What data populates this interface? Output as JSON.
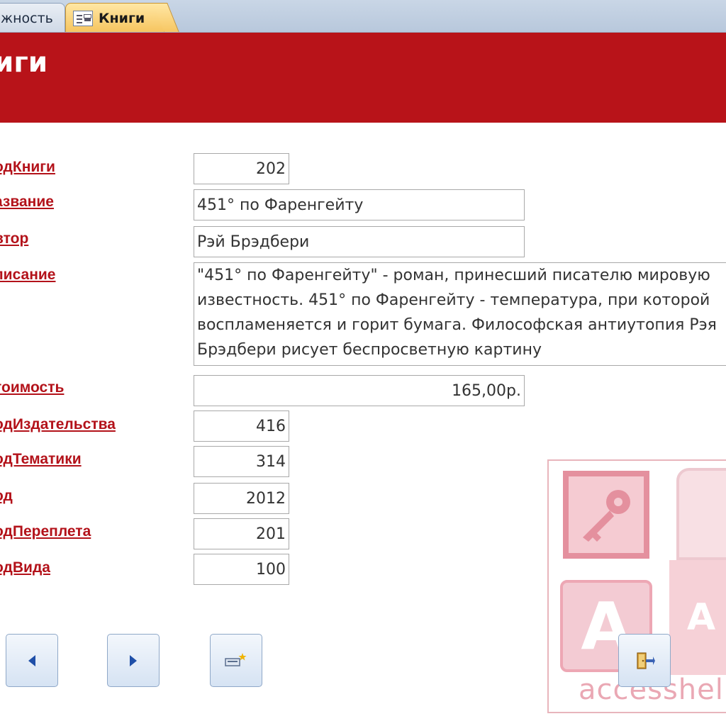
{
  "tabs": {
    "previous": {
      "label": "жность"
    },
    "active": {
      "label": "Книги"
    }
  },
  "header": {
    "title": "иги"
  },
  "fields": {
    "kod_knigi": {
      "label": "одКниги",
      "value": "202"
    },
    "nazvanie": {
      "label": "азвание",
      "value": "451° по Фаренгейту"
    },
    "avtor": {
      "label": "втор",
      "value": "Рэй Брэдбери"
    },
    "opisanie": {
      "label": "писание",
      "value": "\"451° по Фаренгейту\" - роман, принесший писателю мировую известность. 451° по Фаренгейту - температура, при которой воспламеняется и горит бумага. Философская антиутопия Рэя Брэдбери рисует беспросветную картину"
    },
    "stoimost": {
      "label": "тоимость",
      "value": "165,00р."
    },
    "kod_izdatelstva": {
      "label": "одИздательства",
      "value": "416"
    },
    "kod_tematiki": {
      "label": "одТематики",
      "value": "314"
    },
    "god": {
      "label": "од",
      "value": "2012"
    },
    "kod_pereplyota": {
      "label": "одПереплета",
      "value": "201"
    },
    "kod_vida": {
      "label": "одВида",
      "value": "100"
    }
  },
  "watermark": {
    "text": "accesshelp.",
    "letter": "A",
    "letter2": "A"
  },
  "icons": {
    "form": "form-icon",
    "prev": "triangle-left-icon",
    "next": "triangle-right-icon",
    "new": "new-record-icon",
    "close": "close-form-icon"
  },
  "colors": {
    "header": "#b81319",
    "label": "#b3121a",
    "tab_active": "#f6c45e"
  }
}
